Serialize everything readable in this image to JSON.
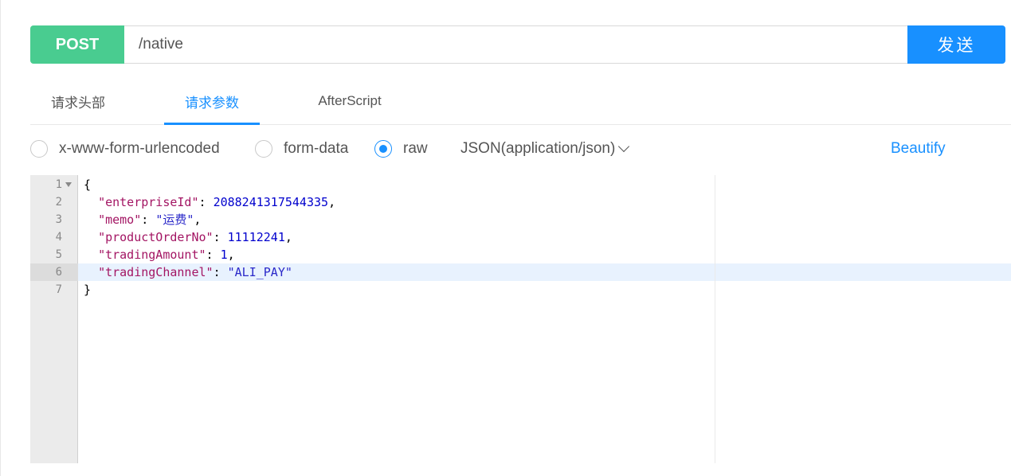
{
  "request": {
    "method": "POST",
    "url": "/native",
    "send_label": "发送"
  },
  "tabs": [
    {
      "label": "请求头部"
    },
    {
      "label": "请求参数"
    },
    {
      "label": "AfterScript"
    }
  ],
  "body_types": {
    "options": [
      {
        "label": "x-www-form-urlencoded"
      },
      {
        "label": "form-data"
      },
      {
        "label": "raw"
      }
    ],
    "selected": "raw",
    "content_type": "JSON(application/json)",
    "beautify_label": "Beautify"
  },
  "editor": {
    "lines": [
      {
        "n": "1",
        "open": "{"
      },
      {
        "n": "2",
        "key": "\"enterpriseId\"",
        "sep": ": ",
        "val": "2088241317544335",
        "tail": ","
      },
      {
        "n": "3",
        "key": "\"memo\"",
        "sep": ": ",
        "val": "\"运费\"",
        "tail": ","
      },
      {
        "n": "4",
        "key": "\"productOrderNo\"",
        "sep": ": ",
        "val": "11112241",
        "tail": ","
      },
      {
        "n": "5",
        "key": "\"tradingAmount\"",
        "sep": ": ",
        "val": "1",
        "tail": ","
      },
      {
        "n": "6",
        "key": "\"tradingChannel\"",
        "sep": ": ",
        "val": "\"ALI_PAY\"",
        "tail": ""
      },
      {
        "n": "7",
        "close": "}"
      }
    ],
    "colors": {
      "key": "#a31563",
      "number": "#0000cd",
      "string": "#2a28c9",
      "active_line": "#e8f2fe"
    }
  }
}
